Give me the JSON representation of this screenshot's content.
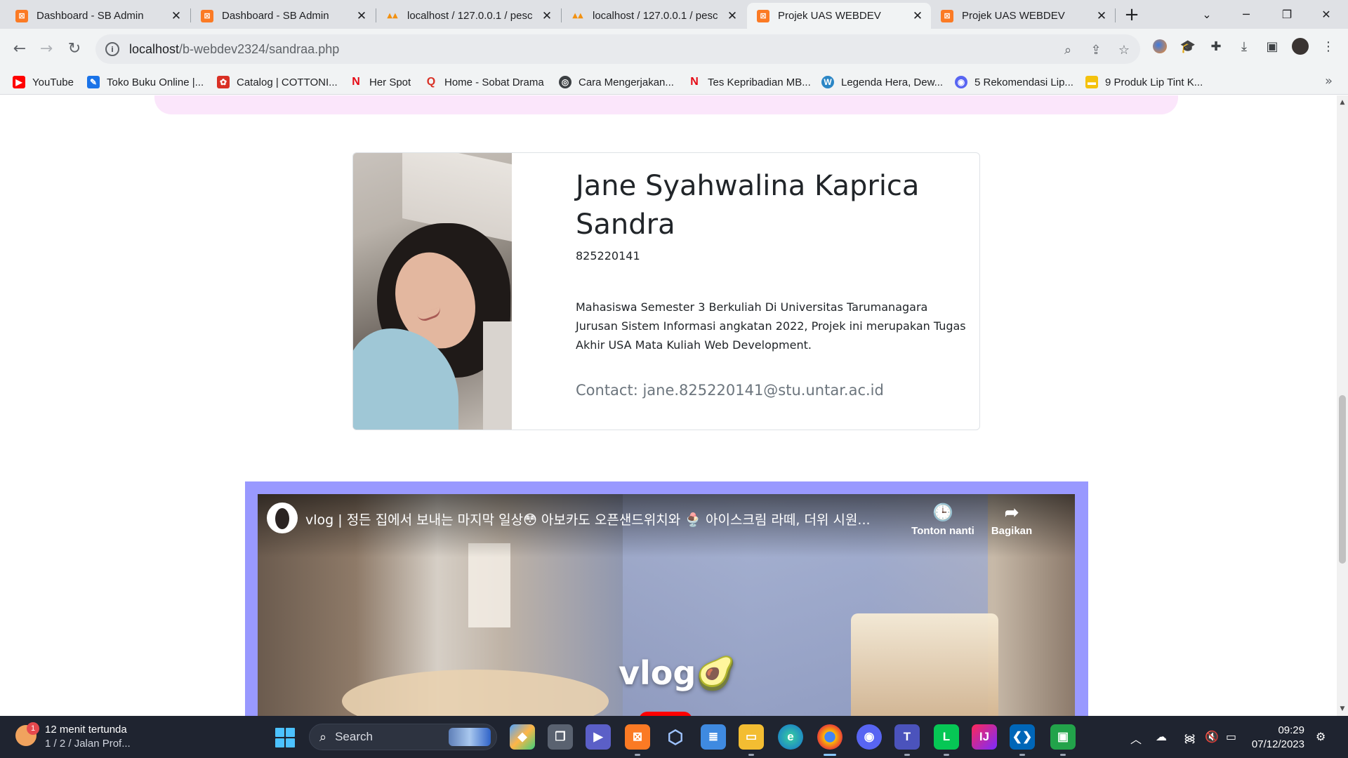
{
  "browser": {
    "tabs": [
      {
        "label": "Dashboard - SB Admin",
        "favicon": "xampp-icon",
        "active": false
      },
      {
        "label": "Dashboard - SB Admin",
        "favicon": "xampp-icon",
        "active": false
      },
      {
        "label": "localhost / 127.0.0.1 / pesc",
        "favicon": "phpmyadmin-icon",
        "active": false
      },
      {
        "label": "localhost / 127.0.0.1 / pesc",
        "favicon": "phpmyadmin-icon",
        "active": false
      },
      {
        "label": "Projek UAS WEBDEV",
        "favicon": "xampp-icon",
        "active": true
      },
      {
        "label": "Projek UAS WEBDEV",
        "favicon": "xampp-icon",
        "active": false
      }
    ],
    "url_host": "localhost",
    "url_path": "/b-webdev2324/sandraa.php",
    "bookmarks": [
      {
        "label": "YouTube",
        "icon": "youtube-icon",
        "color": "#ff0000"
      },
      {
        "label": "Toko Buku Online |...",
        "icon": "bookstore-icon",
        "color": "#1a73e8"
      },
      {
        "label": "Catalog | COTTONI...",
        "icon": "catalog-icon",
        "color": "#d93025"
      },
      {
        "label": "Her Spot",
        "icon": "netflix-icon",
        "color": "#e50914"
      },
      {
        "label": "Home - Sobat Drama",
        "icon": "sobatdrama-icon",
        "color": "#d93025"
      },
      {
        "label": "Cara Mengerjakan...",
        "icon": "globe-icon",
        "color": "#3c4043"
      },
      {
        "label": "Tes Kepribadian MB...",
        "icon": "netflix-icon",
        "color": "#e50914"
      },
      {
        "label": "Legenda Hera, Dew...",
        "icon": "wordpress-icon",
        "color": "#2b86c5"
      },
      {
        "label": "5 Rekomendasi Lip...",
        "icon": "discord-icon",
        "color": "#5865f2"
      },
      {
        "label": "9 Produk Lip Tint K...",
        "icon": "bookmark-icon",
        "color": "#f4c20d"
      }
    ]
  },
  "profile": {
    "name": "Jane Syahwalina Kaprica Sandra",
    "nim": "825220141",
    "description": "Mahasiswa Semester 3 Berkuliah Di Universitas Tarumanagara Jurusan Sistem Informasi angkatan 2022, Projek ini merupakan Tugas Akhir USA Mata Kuliah Web Development.",
    "contact": "Contact: jane.825220141@stu.untar.ac.id"
  },
  "video": {
    "title": "vlog | 정든 집에서 보내는 마지막 일상😳 아보카도 오픈샌드위치와 🍨 아이스크림 라떼, 더위 시원...",
    "watch_later": "Tonton nanti",
    "share": "Bagikan",
    "overlay_text": "vlog🥑"
  },
  "taskbar": {
    "weather_line1": "12 menit tertunda",
    "weather_line2": "1 / 2 / Jalan Prof...",
    "weather_badge": "1",
    "search_placeholder": "Search",
    "time": "09:29",
    "date": "07/12/2023"
  },
  "colors": {
    "video_frame": "#9999ff",
    "pink_header": "#fbe6fb",
    "taskbar_bg": "#1f2430"
  }
}
